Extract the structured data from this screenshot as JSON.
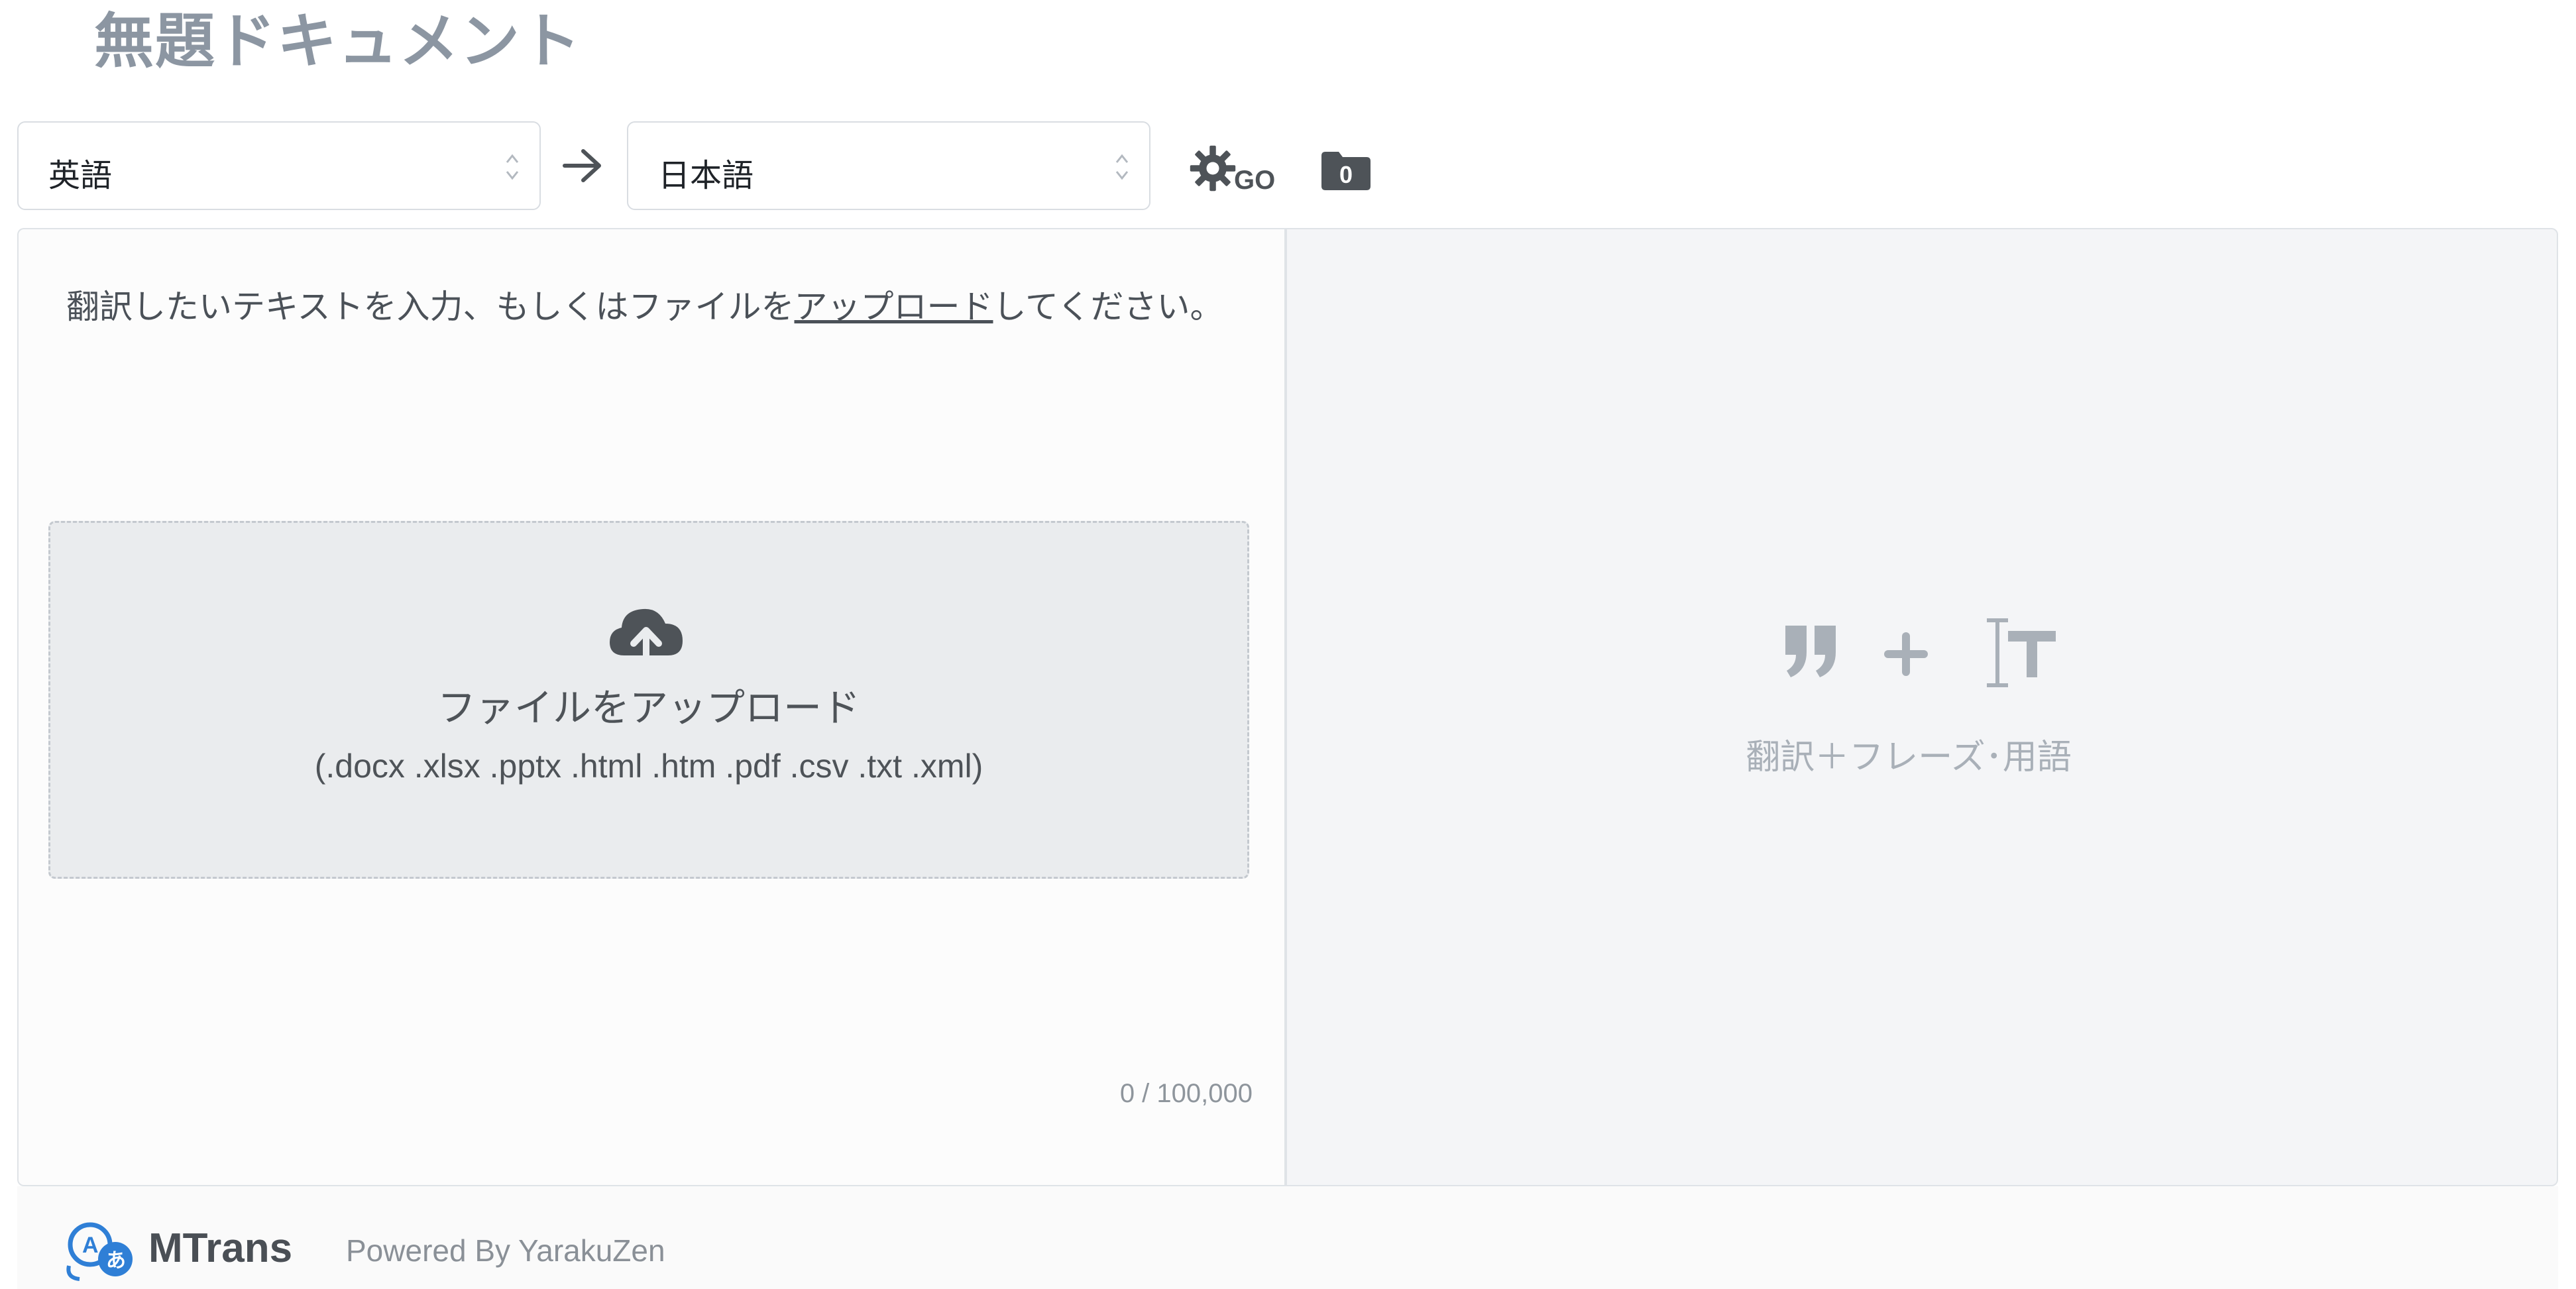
{
  "document": {
    "title": "無題ドキュメント"
  },
  "toolbar": {
    "source_language": "英語",
    "target_language": "日本語",
    "go_label": "GO",
    "folder_count": "0"
  },
  "source_panel": {
    "hint_prefix": "翻訳したいテキストを入力、もしくはファイルを",
    "hint_link": "アップロード",
    "hint_suffix": "してください。",
    "dropzone_title": "ファイルをアップロード",
    "dropzone_formats": "(.docx .xlsx .pptx .html .htm .pdf .csv .txt .xml)",
    "char_counter": "0 / 100,000"
  },
  "target_panel": {
    "caption": "翻訳＋フレーズ･用語"
  },
  "footer": {
    "brand": "MTrans",
    "powered_by": "Powered By YarakuZen"
  },
  "colors": {
    "title_gray": "#8c96a2",
    "icon_dark": "#4e5358",
    "icon_light": "#a9b0b8",
    "logo_blue": "#2f7fd6"
  },
  "icons": [
    "chevron-updown-icon",
    "arrow-right-icon",
    "gear-icon",
    "folder-icon",
    "cloud-upload-icon",
    "quote-icon",
    "plus-icon",
    "text-cursor-icon"
  ]
}
